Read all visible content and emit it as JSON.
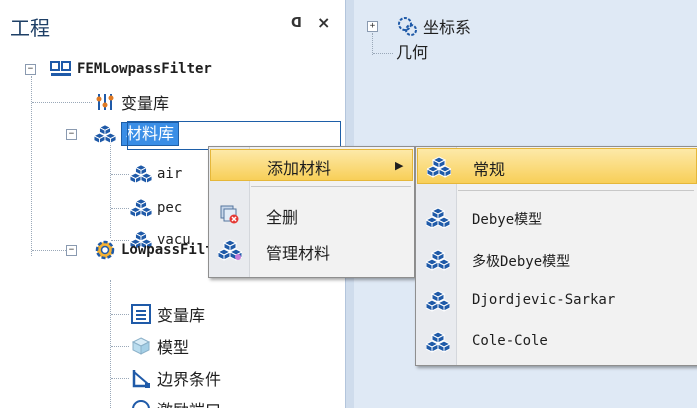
{
  "panel": {
    "title": "工程",
    "pin_glyph": "ᗡ",
    "close_glyph": "×"
  },
  "tree": {
    "project": "FEMLowpassFilter",
    "variables": "变量库",
    "materials": "材料库",
    "material_items": [
      "air",
      "pec",
      "vacu"
    ],
    "component": "LowpassFilter",
    "comp_variables": "变量库",
    "model": "模型",
    "boundary": "边界条件",
    "excitation": "激励端口"
  },
  "right_tree": {
    "coord": "坐标系",
    "geometry": "几何"
  },
  "context_menu": {
    "add_material": "添加材料",
    "delete_all": "全删",
    "manage_materials": "管理材料"
  },
  "submenu": {
    "items": [
      "常规",
      "Debye模型",
      "多极Debye模型",
      "Djordjevic-Sarkar",
      "Cole-Cole"
    ]
  },
  "colors": {
    "accent_blue": "#3a8ee6",
    "menu_highlight": "#f8cf58",
    "material_icon": "#1f5aa8"
  }
}
